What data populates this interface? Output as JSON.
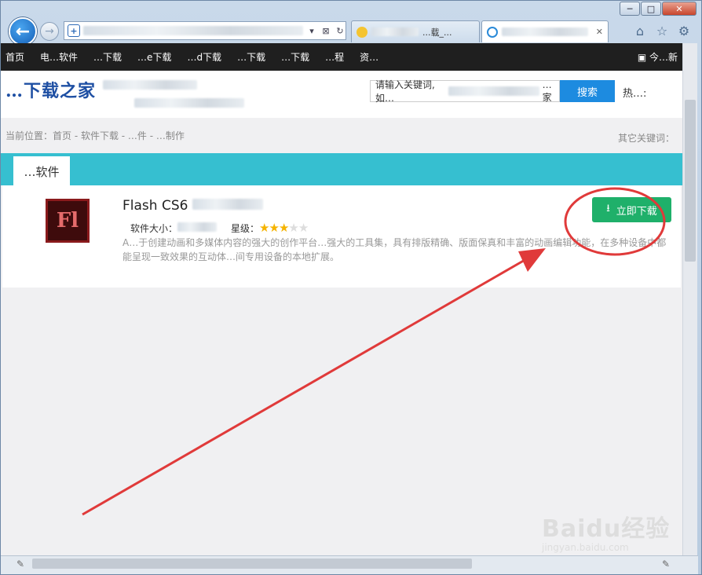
{
  "browser": {
    "tabs": [
      {
        "label": "...载_..."
      },
      {
        "label": "..."
      }
    ],
    "caption": {
      "minimize": "─",
      "maximize": "□",
      "close": "✕"
    }
  },
  "site": {
    "nav": [
      "首页",
      "电…软件",
      "…下载",
      "…e下载",
      "…d下载",
      "…下载",
      "…下载",
      "…程",
      "资…"
    ],
    "nav_right": "今…新",
    "logo": "…下载之家",
    "slogan": "…",
    "search_placeholder": "请输入关键词,如…",
    "search_tail": "…家",
    "search_button": "搜索",
    "hot_label": "热…:",
    "breadcrumb": "当前位置：首页 - 软件下载 - …件 - …制作",
    "other_keywords": "其它关键词：",
    "section_tab": "…软件"
  },
  "app": {
    "title": "Flash CS6",
    "size_label": "软件大小：",
    "rating_label": "星级：",
    "rating_filled": 3,
    "rating_total": 5,
    "icon_text": "Fl",
    "description": "A…于创建动画和多媒体内容的强大的创作平台…强大的工具集，具有排版精确、版面保真和丰富的动画编辑功能，在多种设备中都能呈现一致效果的互动体…间专用设备的本地扩展。",
    "download_button": "立即下载"
  },
  "watermark": {
    "brand": "Baidu经验",
    "url": "jingyan.baidu.com"
  },
  "colors": {
    "accent": "#36bfd0",
    "download": "#1fb06a",
    "search": "#1d8be0",
    "annotation": "#e03a3a"
  }
}
